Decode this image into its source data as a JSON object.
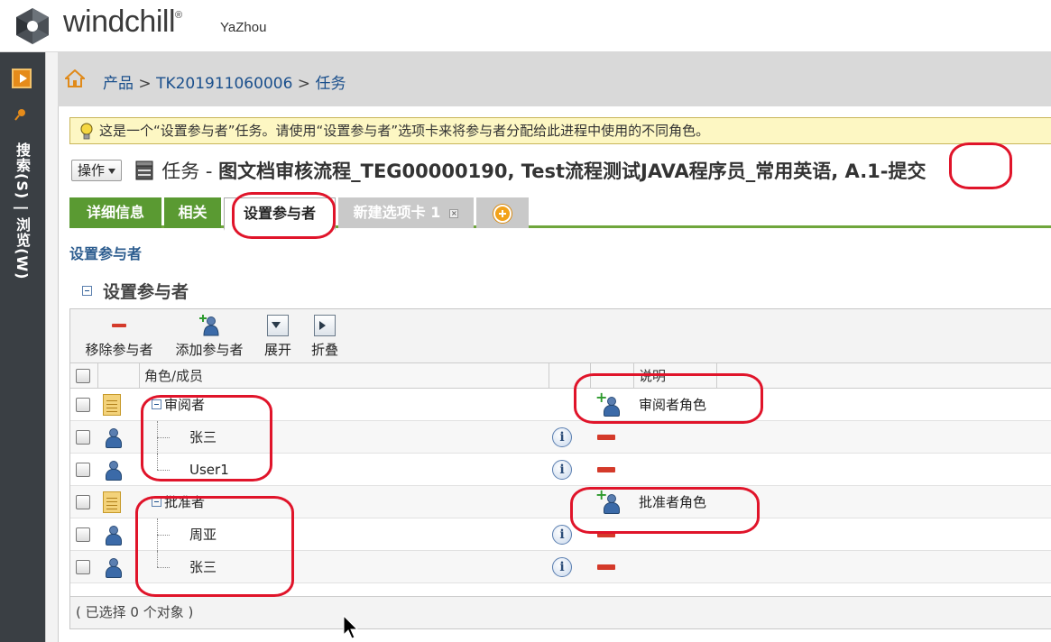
{
  "header": {
    "logo_text": "windchill",
    "trademark": "®",
    "user_name": "YaZhou"
  },
  "left_rail": {
    "vertical_label": "搜索(S) | 浏览(W)"
  },
  "breadcrumb": {
    "items": [
      "产品",
      "TK201911060006",
      "任务"
    ],
    "separator": ">"
  },
  "info_message": "这是一个“设置参与者”任务。请使用“设置参与者”选项卡来将参与者分配给此进程中使用的不同角色。",
  "title_row": {
    "action_button": "操作",
    "prefix": "任务 - ",
    "title": "图文档审核流程_TEG00000190, Test流程测试JAVA程序员_常用英语, A.1-提交"
  },
  "tabs": [
    {
      "label": "详细信息"
    },
    {
      "label": "相关"
    },
    {
      "label": "设置参与者"
    },
    {
      "label": "新建选项卡 1"
    }
  ],
  "section_link": "设置参与者",
  "section_title": "设置参与者",
  "toolbar": {
    "remove_label": "移除参与者",
    "add_label": "添加参与者",
    "expand_label": "展开",
    "collapse_label": "折叠"
  },
  "grid": {
    "col_role": "角色/成员",
    "col_description": "说明",
    "rows": [
      {
        "type": "role",
        "name": "审阅者",
        "description": "审阅者角色"
      },
      {
        "type": "member",
        "name": "张三"
      },
      {
        "type": "member",
        "name": "User1"
      },
      {
        "type": "role",
        "name": "批准者",
        "description": "批准者角色"
      },
      {
        "type": "member",
        "name": "周亚"
      },
      {
        "type": "member",
        "name": "张三"
      }
    ]
  },
  "status_text": "( 已选择 0 个对象 )",
  "colors": {
    "accent_green": "#5a9a32",
    "annotation_red": "#e0142a",
    "link_blue": "#1a4f8c"
  }
}
